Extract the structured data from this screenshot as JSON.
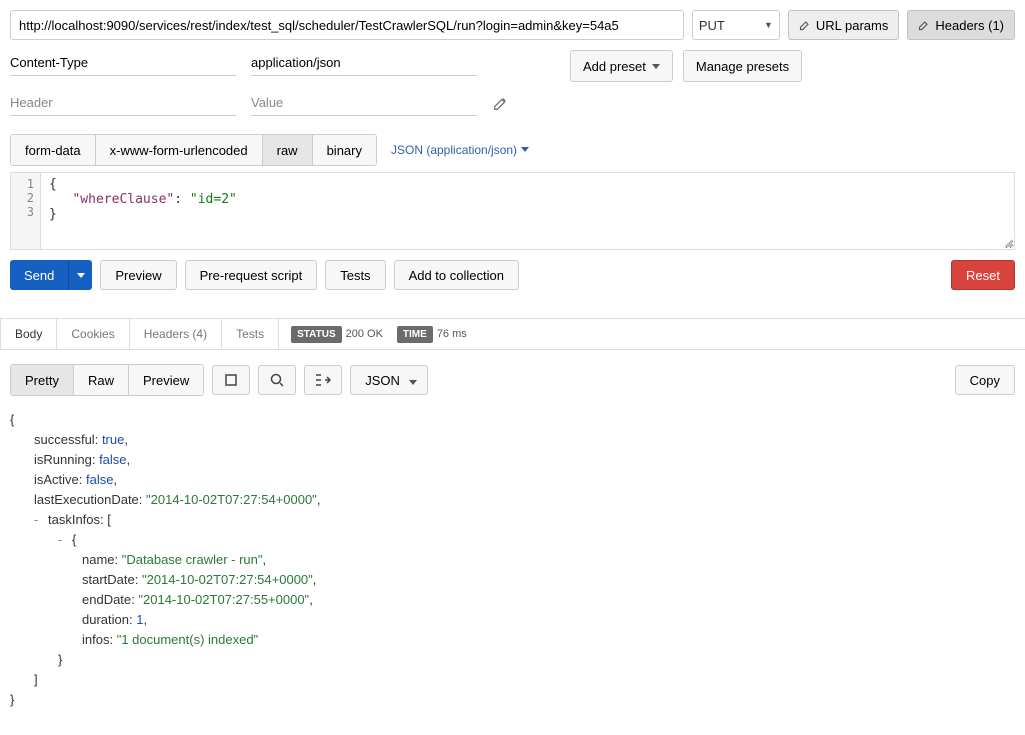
{
  "url": "http://localhost:9090/services/rest/index/test_sql/scheduler/TestCrawlerSQL/run?login=admin&key=54a5",
  "method": "PUT",
  "top_buttons": {
    "url_params": "URL params",
    "headers": "Headers (1)"
  },
  "headers": {
    "name_ph": "Header",
    "value_ph": "Value",
    "row1": {
      "name": "Content-Type",
      "value": "application/json"
    }
  },
  "presets": {
    "add": "Add preset",
    "manage": "Manage presets"
  },
  "body_types": {
    "form": "form-data",
    "xwww": "x-www-form-urlencoded",
    "raw": "raw",
    "binary": "binary"
  },
  "raw_subtype": "JSON (application/json)",
  "editor": {
    "gutter": [
      "1",
      "2",
      "3"
    ],
    "line1": "{",
    "key": "\"whereClause\"",
    "val": "\"id=2\"",
    "line3": "}"
  },
  "actions": {
    "send": "Send",
    "preview": "Preview",
    "prereq": "Pre-request script",
    "tests": "Tests",
    "addcol": "Add to collection",
    "reset": "Reset"
  },
  "resp": {
    "tabs": {
      "body": "Body",
      "cookies": "Cookies",
      "headers": "Headers (4)",
      "tests": "Tests"
    },
    "status_lbl": "STATUS",
    "status_val": "200 OK",
    "time_lbl": "TIME",
    "time_val": "76 ms"
  },
  "view": {
    "pretty": "Pretty",
    "raw": "Raw",
    "preview": "Preview",
    "json": "JSON",
    "copy": "Copy"
  },
  "json": {
    "successful_k": "successful",
    "successful_v": "true",
    "isRunning_k": "isRunning",
    "isRunning_v": "false",
    "isActive_k": "isActive",
    "isActive_v": "false",
    "lastExec_k": "lastExecutionDate",
    "lastExec_v": "\"2014-10-02T07:27:54+0000\"",
    "taskInfos_k": "taskInfos",
    "name_k": "name",
    "name_v": "\"Database crawler - run\"",
    "startDate_k": "startDate",
    "startDate_v": "\"2014-10-02T07:27:54+0000\"",
    "endDate_k": "endDate",
    "endDate_v": "\"2014-10-02T07:27:55+0000\"",
    "duration_k": "duration",
    "duration_v": "1",
    "infos_k": "infos",
    "infos_v": "\"1 document(s) indexed\""
  }
}
